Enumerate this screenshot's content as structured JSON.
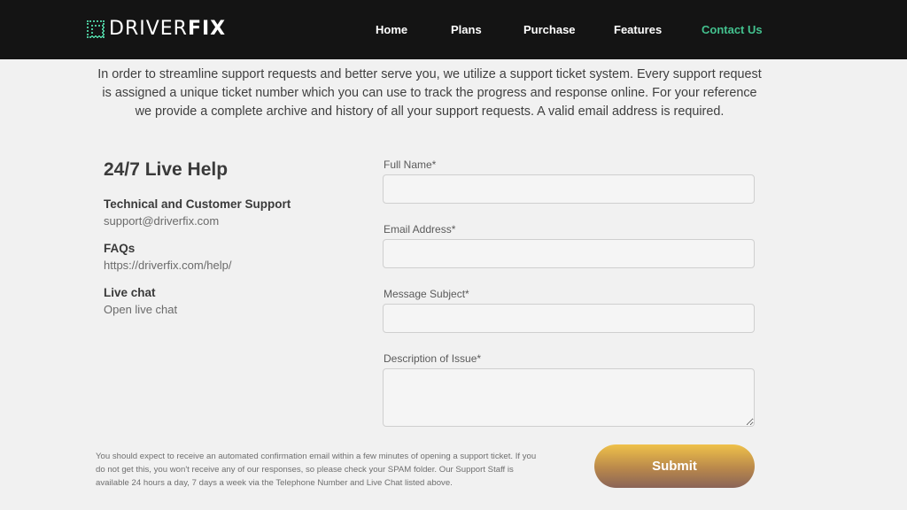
{
  "header": {
    "logo": {
      "light": "DRIVER",
      "bold": "FIX"
    },
    "nav": [
      {
        "label": "Home",
        "active": false
      },
      {
        "label": "Plans",
        "active": false
      },
      {
        "label": "Purchase",
        "active": false
      },
      {
        "label": "Features",
        "active": false
      },
      {
        "label": "Contact Us",
        "active": true
      }
    ]
  },
  "intro": "In order to streamline support requests and better serve you, we utilize a support ticket system. Every support request is assigned a unique ticket number which you can use to track the progress and response online. For your reference we provide a complete archive and history of all your support requests. A valid email address is required.",
  "help": {
    "title": "24/7 Live Help",
    "items": [
      {
        "heading": "Technical and Customer Support",
        "value": "support@driverfix.com"
      },
      {
        "heading": "FAQs",
        "value": "https://driverfix.com/help/"
      },
      {
        "heading": "Live chat",
        "value": "Open live chat"
      }
    ]
  },
  "form": {
    "full_name": {
      "label": "Full Name*",
      "value": ""
    },
    "email": {
      "label": "Email Address*",
      "value": ""
    },
    "subject": {
      "label": "Message Subject*",
      "value": ""
    },
    "description": {
      "label": "Description of Issue*",
      "value": ""
    },
    "submit_label": "Submit"
  },
  "note": "You should expect to receive an automated confirmation email within a few minutes of opening a support ticket. If you do not get this, you won't receive any of our responses, so please check your SPAM folder. Our Support Staff is available 24 hours a day, 7 days a week via the Telephone Number and Live Chat listed above.",
  "colors": {
    "nav_bg": "#141414",
    "accent": "#43c18e",
    "submit_top": "#efc14a",
    "submit_bottom": "#8a6457",
    "page_bg": "#f1f1f1"
  }
}
